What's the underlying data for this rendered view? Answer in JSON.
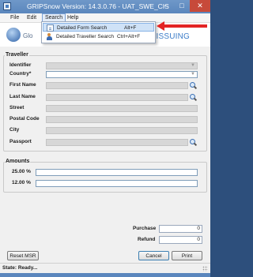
{
  "window": {
    "title": "GRIPSnow Version: 14.3.0.76 - UAT_SWE_CIS"
  },
  "menu": {
    "file": "File",
    "edit": "Edit",
    "search": "Search",
    "help": "Help"
  },
  "search_menu": {
    "items": [
      {
        "label": "Detailed Form Search",
        "shortcut": "Alt+F",
        "icon": "document-search-icon"
      },
      {
        "label": "Detailed Traveller Search",
        "shortcut": "Ctrl+Alt+F",
        "icon": "person-search-icon"
      }
    ]
  },
  "header": {
    "logo_text": "Glo",
    "title": "M ISSUING"
  },
  "traveller": {
    "group_label": "Traveller",
    "identifier_label": "Identifier",
    "country_label": "Country*",
    "first_name_label": "First Name",
    "last_name_label": "Last Name",
    "street_label": "Street",
    "postal_code_label": "Postal Code",
    "city_label": "City",
    "passport_label": "Passport"
  },
  "amounts": {
    "group_label": "Amounts",
    "rows": [
      {
        "label": "25.00 %"
      },
      {
        "label": "12.00 %"
      }
    ]
  },
  "totals": {
    "purchase_label": "Purchase",
    "purchase_value": "0",
    "refund_label": "Refund",
    "refund_value": "0"
  },
  "buttons": {
    "reset": "Reset MSR",
    "cancel": "Cancel",
    "print": "Print"
  },
  "status": {
    "text": "State: Ready..."
  },
  "colors": {
    "titlebar": "#5a86bd",
    "accent_title": "#3d7dc8",
    "arrow": "#e32424",
    "menu_highlight": "#cfe2f7"
  }
}
